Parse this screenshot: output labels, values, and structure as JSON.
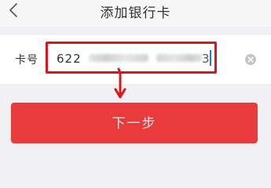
{
  "header": {
    "title": "添加银行卡",
    "back_icon": "chevron-left-icon"
  },
  "form": {
    "card_label": "卡号",
    "card_value_prefix": "622",
    "card_value_suffix": "3",
    "card_value_masked": true,
    "clear_icon": "clear-circle-icon"
  },
  "actions": {
    "next_label": "下一步"
  },
  "colors": {
    "highlight_red": "#d9161c",
    "button_red": "#e93b3b",
    "cursor_blue": "#2b72e8"
  }
}
